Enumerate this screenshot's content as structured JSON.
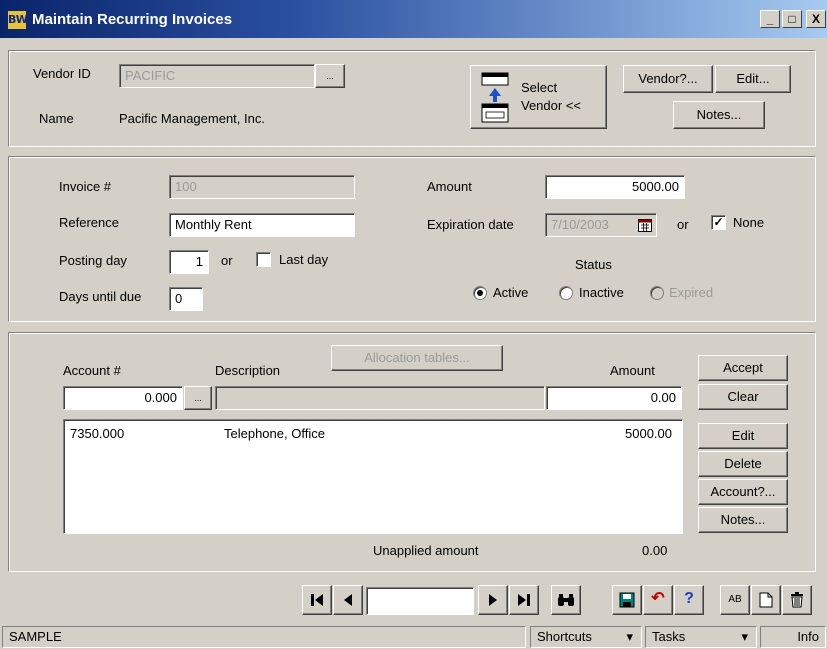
{
  "window": {
    "title": "Maintain Recurring Invoices",
    "app_icon_text": "BW",
    "minimize": "_",
    "maximize": "□",
    "close": "X"
  },
  "vendor": {
    "id_label": "Vendor ID",
    "id_value": "PACIFIC",
    "browse_label": "...",
    "name_label": "Name",
    "name_value": "Pacific Management, Inc.",
    "select_line1": "Select",
    "select_line2": "Vendor <<",
    "vendor_btn": "Vendor?...",
    "edit_btn": "Edit...",
    "notes_btn": "Notes..."
  },
  "invoice": {
    "invoice_label": "Invoice #",
    "invoice_value": "100",
    "reference_label": "Reference",
    "reference_value": "Monthly Rent",
    "posting_label": "Posting day",
    "posting_value": "1",
    "or1": "or",
    "lastday_label": "Last day",
    "daysdue_label": "Days until due",
    "daysdue_value": "0",
    "amount_label": "Amount",
    "amount_value": "5000.00",
    "expiration_label": "Expiration date",
    "expiration_value": "7/10/2003",
    "or2": "or",
    "none_label": "None",
    "none_checked": true,
    "status_label": "Status",
    "active": "Active",
    "inactive": "Inactive",
    "expired": "Expired",
    "status_selected": "Active"
  },
  "lines": {
    "allocation_btn": "Allocation tables...",
    "account_header": "Account #",
    "description_header": "Description",
    "amount_header": "Amount",
    "account_input": "0.000",
    "browse_label": "...",
    "amount_input": "0.00",
    "rows": [
      {
        "account": "7350.000",
        "description": "Telephone, Office",
        "amount": "5000.00"
      }
    ],
    "unapplied_label": "Unapplied amount",
    "unapplied_value": "0.00",
    "accept_btn": "Accept",
    "clear_btn": "Clear",
    "edit_btn": "Edit",
    "delete_btn": "Delete",
    "account_btn": "Account?...",
    "notes_btn": "Notes..."
  },
  "toolbar": {
    "first": "⏮",
    "prev": "◀",
    "record_value": "",
    "next": "▶",
    "last": "⏭",
    "find": "🔍",
    "save": "💾",
    "undo": "↶",
    "help": "?",
    "spell": "AB",
    "new": "🗋",
    "delete": "🗑"
  },
  "statusbar": {
    "left": "SAMPLE",
    "shortcuts": "Shortcuts",
    "tasks": "Tasks",
    "info": "Info"
  }
}
